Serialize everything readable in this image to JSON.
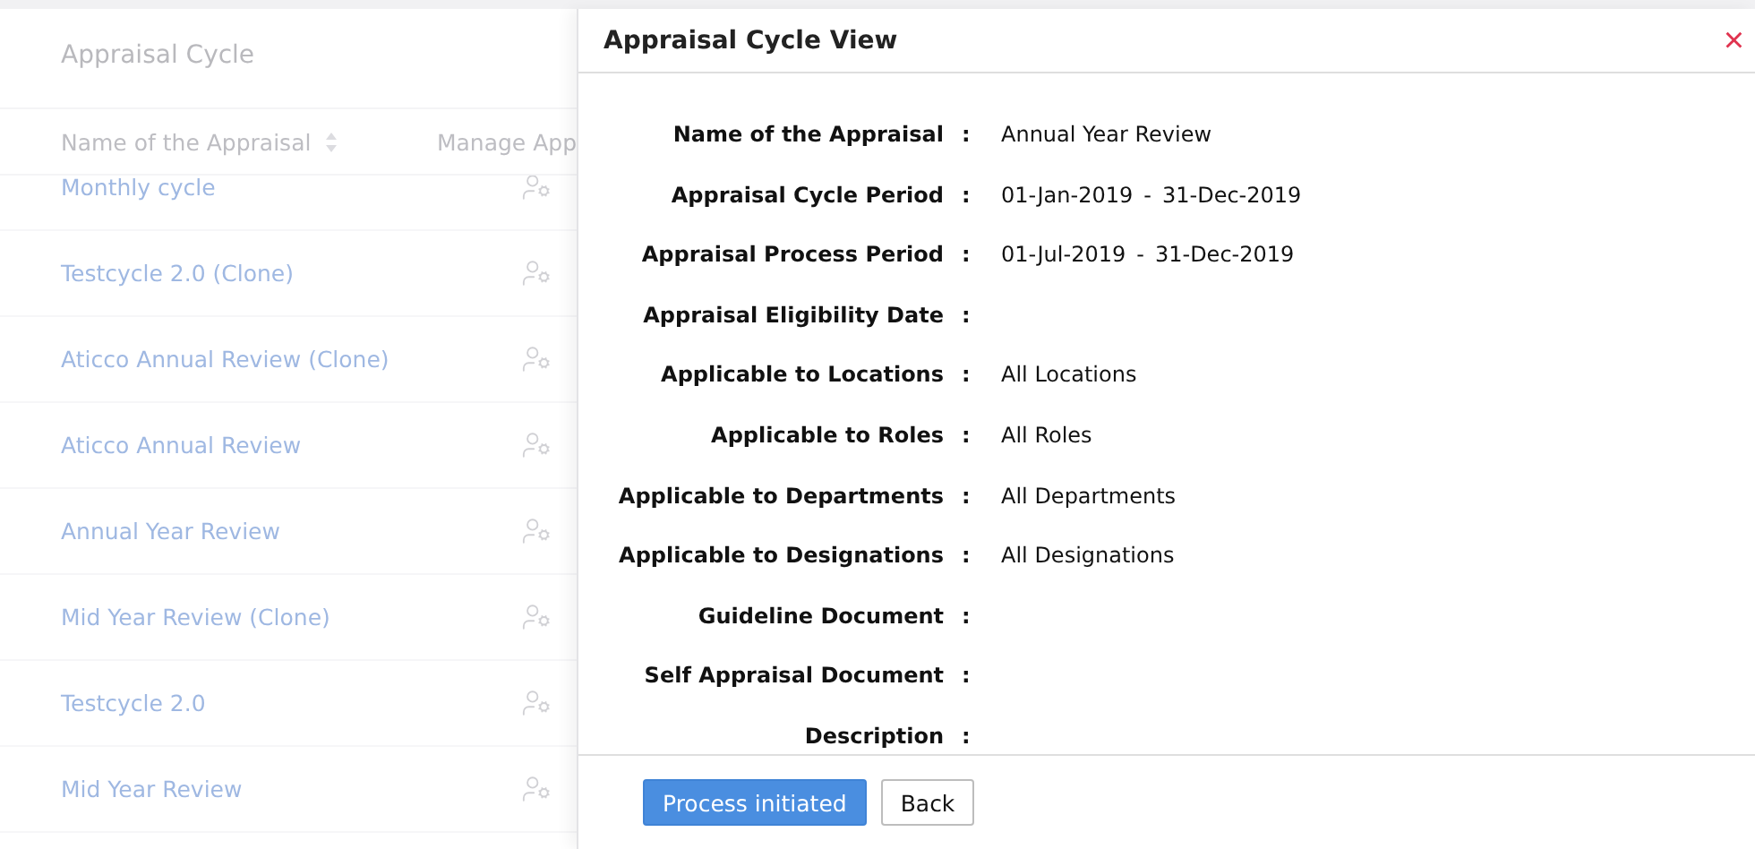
{
  "page": {
    "title": "Appraisal Cycle",
    "table": {
      "columns": [
        "Name of the Appraisal",
        "Manage App"
      ],
      "rows": [
        {
          "name": "Monthly cycle"
        },
        {
          "name": "Testcycle 2.0 (Clone)"
        },
        {
          "name": "Aticco Annual Review (Clone)"
        },
        {
          "name": "Aticco Annual Review"
        },
        {
          "name": "Annual Year Review"
        },
        {
          "name": "Mid Year Review (Clone)"
        },
        {
          "name": "Testcycle 2.0"
        },
        {
          "name": "Mid Year Review"
        }
      ]
    }
  },
  "dialog": {
    "title": "Appraisal Cycle View",
    "close": "×",
    "fields": [
      {
        "label": "Name of the Appraisal",
        "value": "Annual Year Review"
      },
      {
        "label": "Appraisal Cycle Period",
        "from": "01-Jan-2019",
        "to": "31-Dec-2019"
      },
      {
        "label": "Appraisal Process Period",
        "from": "01-Jul-2019",
        "to": "31-Dec-2019"
      },
      {
        "label": "Appraisal Eligibility Date"
      },
      {
        "label": "Applicable to Locations",
        "value": "All Locations"
      },
      {
        "label": "Applicable to Roles",
        "value": "All Roles"
      },
      {
        "label": "Applicable to Departments",
        "value": "All Departments"
      },
      {
        "label": "Applicable to Designations",
        "value": "All Designations"
      },
      {
        "label": "Guideline Document"
      },
      {
        "label": "Self Appraisal Document"
      },
      {
        "label": "Description"
      }
    ],
    "separator": ":",
    "range_separator": "-",
    "buttons": [
      {
        "label": "Process initiated",
        "kind": "primary"
      },
      {
        "label": "Back",
        "kind": "secondary"
      }
    ]
  }
}
